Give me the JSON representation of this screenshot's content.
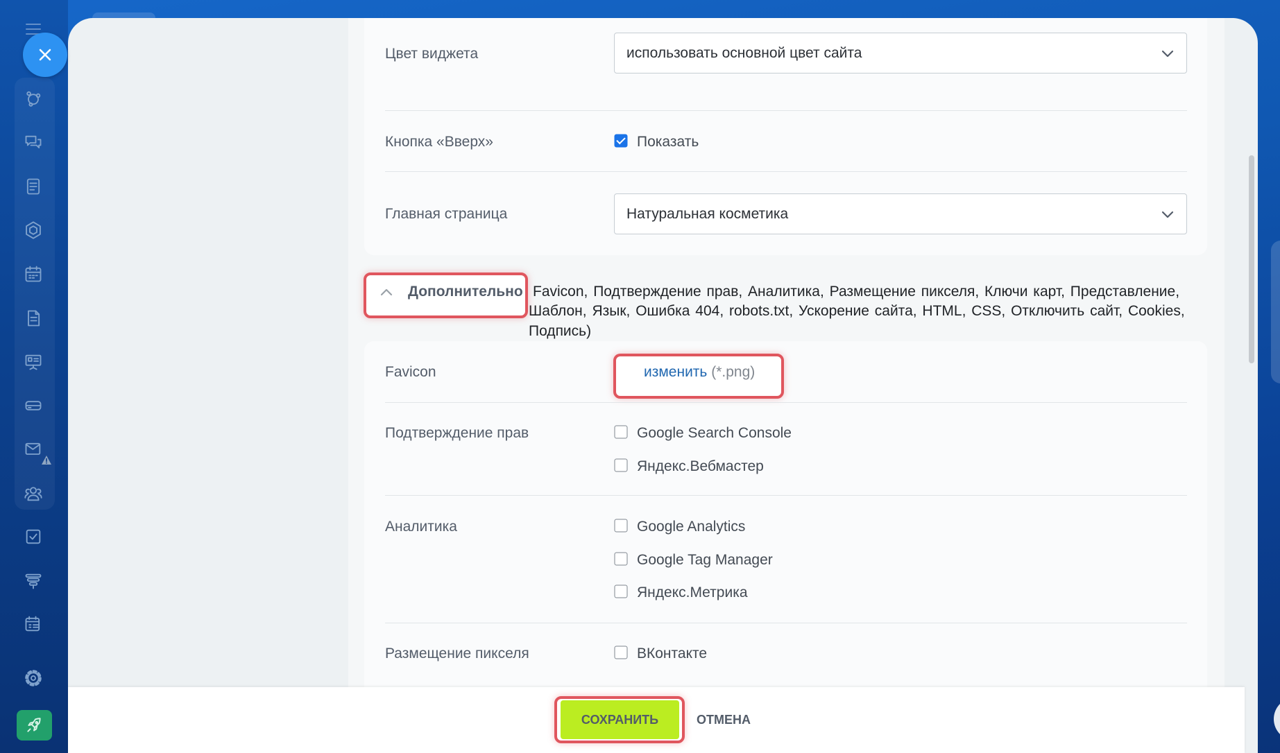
{
  "sidebar": {
    "menu_icon": "hamburger-icon",
    "close_icon": "close-icon",
    "icons": [
      "nodes-icon",
      "chat-icon",
      "feed-icon",
      "hexagon-icon",
      "calendar-icon",
      "document-icon",
      "presentation-icon",
      "drive-icon",
      "mail-icon",
      "users-icon",
      "tasks-icon",
      "filter-icon",
      "schedule-icon",
      "gear-icon",
      "rocket-icon"
    ],
    "mail_badge_icon": "warning-icon"
  },
  "settings": {
    "widget_color": {
      "label": "Цвет виджета",
      "value": "использовать основной цвет сайта"
    },
    "scroll_up_button": {
      "label": "Кнопка «Вверх»",
      "option": "Показать",
      "checked": true
    },
    "home_page": {
      "label": "Главная страница",
      "value": "Натуральная косметика"
    }
  },
  "advanced": {
    "toggle_label": "Дополнительно",
    "expanded": true,
    "summary_lines": [
      "Favicon, Подтверждение прав, Аналитика, Размещение пикселя, Ключи карт, Представление,",
      "Шаблон, Язык, Ошибка 404, robots.txt, Ускорение сайта, HTML, CSS, Отключить сайт, Cookies,",
      "Подпись)"
    ],
    "favicon": {
      "label": "Favicon",
      "change_link": "изменить",
      "format_hint": "(*.png)"
    },
    "rights_confirmation": {
      "label": "Подтверждение прав",
      "options": [
        {
          "label": "Google Search Console",
          "checked": false
        },
        {
          "label": "Яндекс.Вебмастер",
          "checked": false
        }
      ]
    },
    "analytics": {
      "label": "Аналитика",
      "options": [
        {
          "label": "Google Analytics",
          "checked": false
        },
        {
          "label": "Google Tag Manager",
          "checked": false
        },
        {
          "label": "Яндекс.Метрика",
          "checked": false
        }
      ]
    },
    "pixel": {
      "label": "Размещение пикселя",
      "options": [
        {
          "label": "ВКонтакте",
          "checked": false
        }
      ]
    }
  },
  "footer": {
    "save_label": "СОХРАНИТЬ",
    "cancel_label": "ОТМЕНА"
  },
  "colors": {
    "save_button": "#bbed21",
    "link": "#2067b0",
    "highlight_frame": "#e0565e",
    "checkbox_checked": "#1a73e8",
    "close_button": "#2d92f2",
    "rocket_button": "#22a06b"
  }
}
